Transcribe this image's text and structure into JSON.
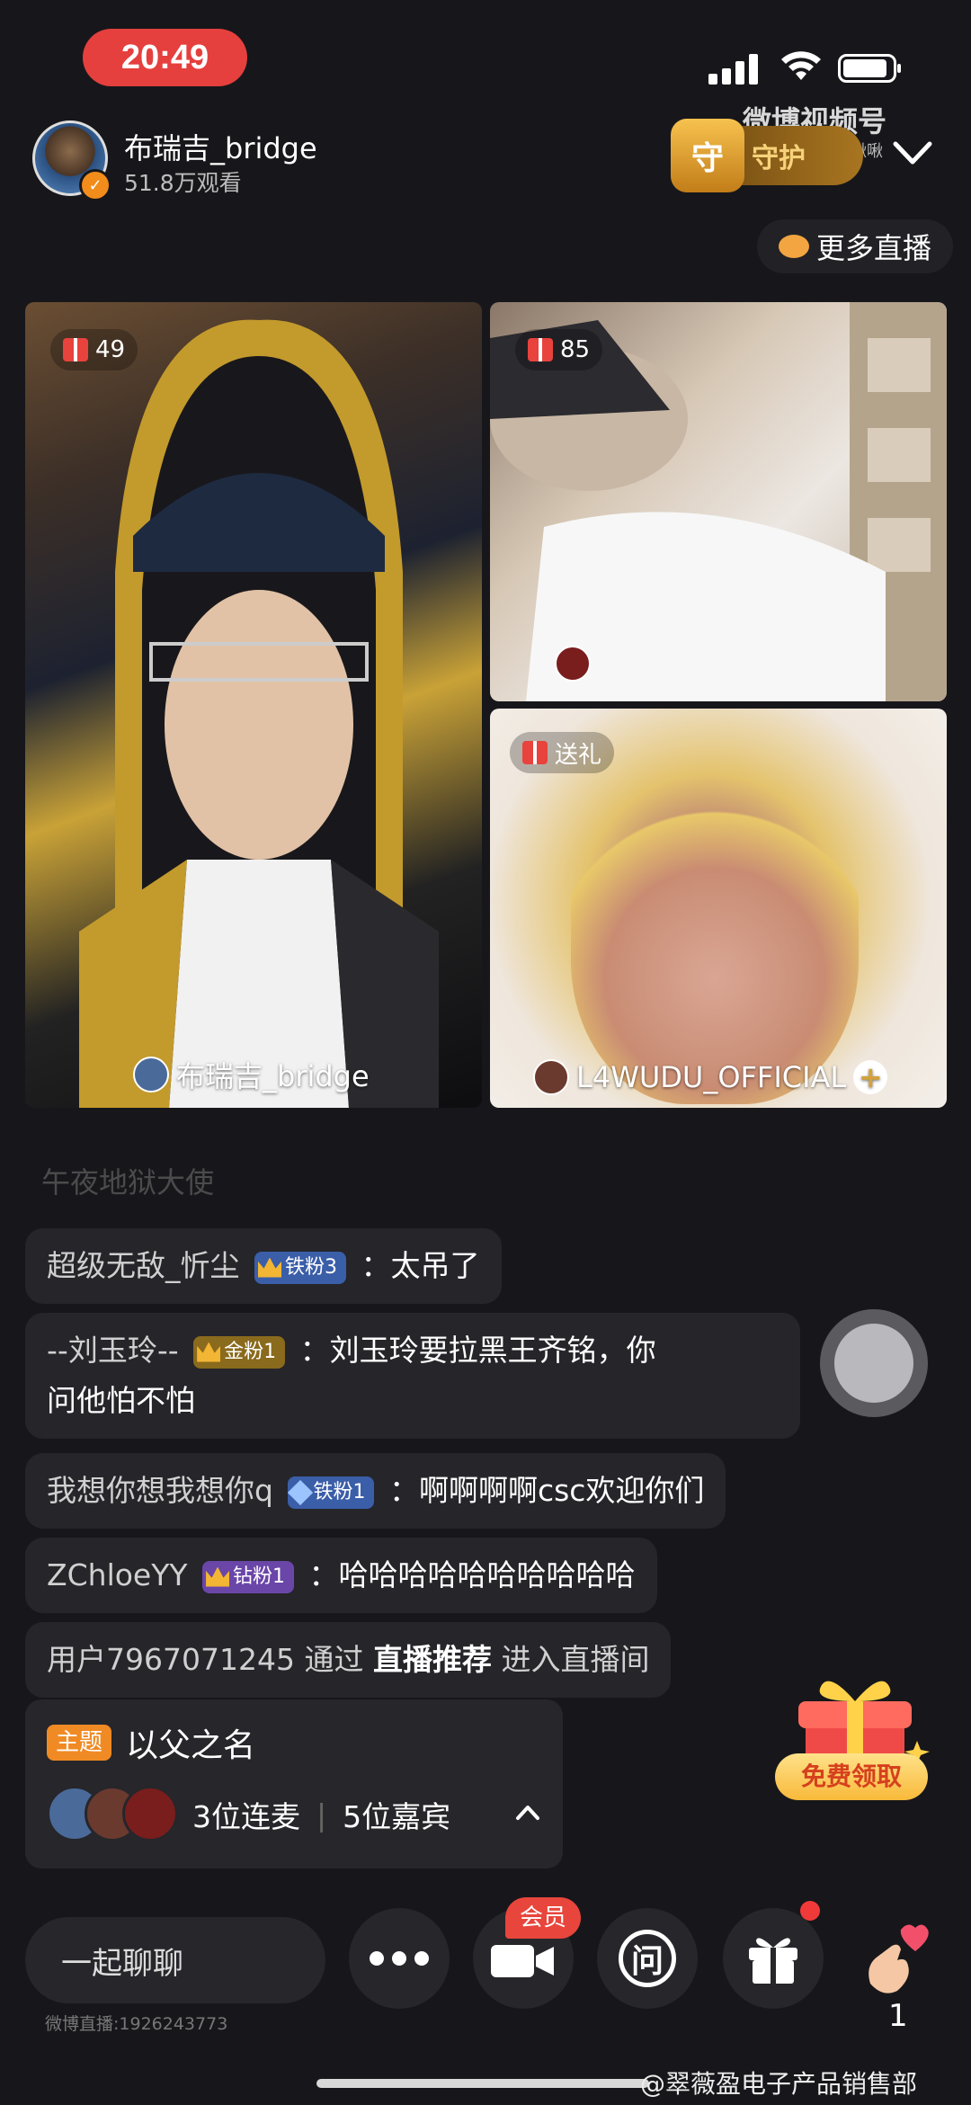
{
  "status_bar": {
    "time": "20:49"
  },
  "header": {
    "host_name": "布瑞吉_bridge",
    "viewers": "51.8万观看",
    "guard_label": "守护",
    "guard_shield": "守",
    "watermark": "微博视频号",
    "watermark_sub": "@叩叩啾啾啾"
  },
  "more_live": "更多直播",
  "tiles": [
    {
      "gift_count": "49",
      "name": "布瑞吉_bridge"
    },
    {
      "gift_count": "85"
    },
    {
      "gift_label": "送礼",
      "name": "L4WUDU_OFFICIAL"
    }
  ],
  "chat": {
    "faded": "午夜地狱大使",
    "messages": [
      {
        "user": "超级无敌_忻尘",
        "fan": "铁粉3",
        "text": "太吊了"
      },
      {
        "user": "--刘玉玲--",
        "fan": "金粉1",
        "text": "刘玉玲要拉黑王齐铭，你",
        "text2": "问他怕不怕"
      },
      {
        "user": "我想你想我想你q",
        "fan": "铁粉1",
        "text": "啊啊啊啊csc欢迎你们"
      },
      {
        "user": "ZChloeYY",
        "fan": "钻粉1",
        "text": "哈哈哈哈哈哈哈哈哈哈"
      }
    ],
    "system": {
      "prefix": "用户7967071245 通过",
      "highlight": "直播推荐",
      "suffix": "进入直播间"
    }
  },
  "theme_card": {
    "tag": "主题",
    "title": "以父之名",
    "connected": "3位连麦",
    "guests": "5位嘉宾"
  },
  "free_gift": "免费领取",
  "bottom_bar": {
    "chat_placeholder": "一起聊聊",
    "vip_label": "会员",
    "ask_label": "问",
    "like_count": "1",
    "room_id": "微博直播:1926243773"
  },
  "watermark_bottom": "@翠薇盈电子产品销售部"
}
